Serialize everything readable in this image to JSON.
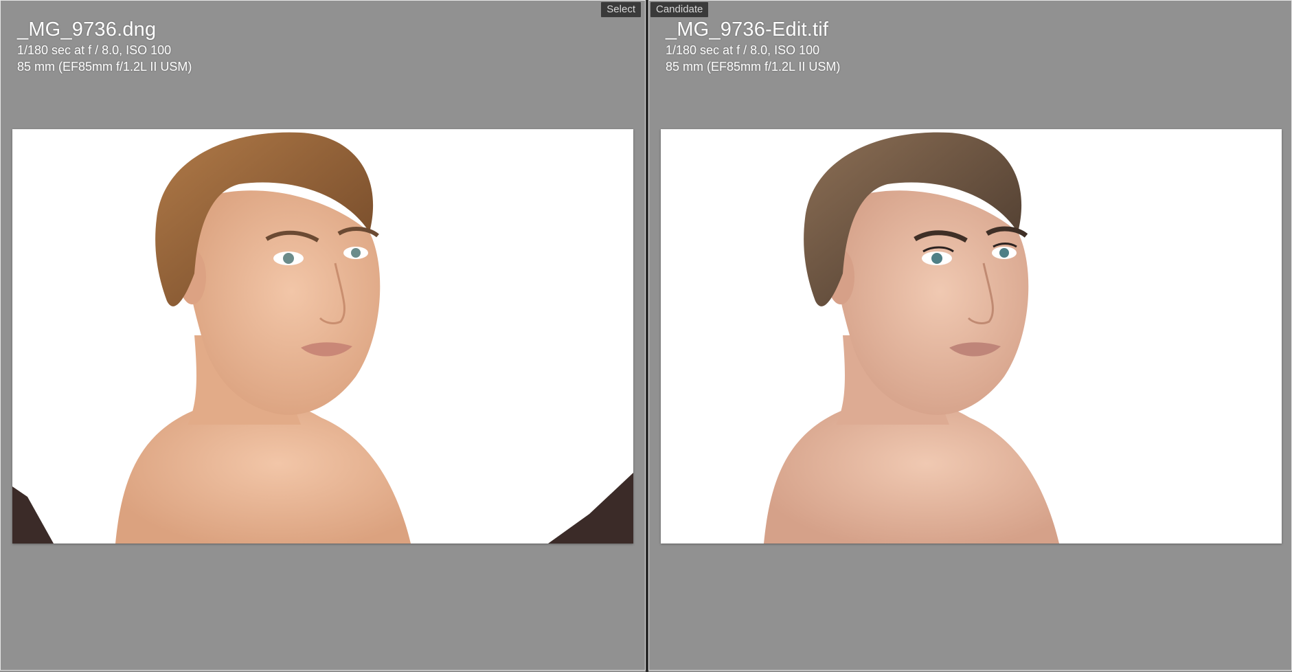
{
  "left": {
    "tag": "Select",
    "filename": "_MG_9736.dng",
    "exposure": "1/180 sec at f / 8.0, ISO 100",
    "lens": "85 mm (EF85mm f/1.2L II USM)"
  },
  "right": {
    "tag": "Candidate",
    "filename": "_MG_9736-Edit.tif",
    "exposure": "1/180 sec at f / 8.0, ISO 100",
    "lens": "85 mm (EF85mm f/1.2L II USM)"
  },
  "colors": {
    "background": "#919191",
    "divider": "#2b2b2b",
    "tag_background": "#3a3a3a",
    "skin_original": "#e8b89a",
    "skin_edit": "#e3b39a",
    "hair_original": "#8a5a34",
    "hair_edit": "#5e4836"
  }
}
